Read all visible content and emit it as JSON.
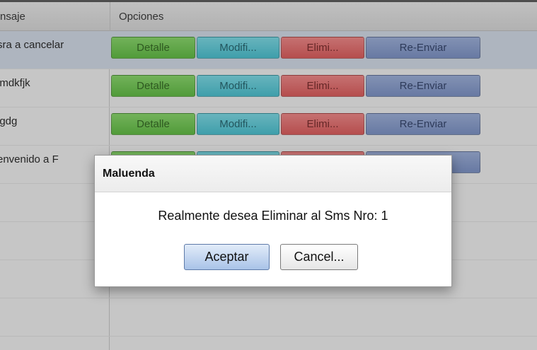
{
  "grid": {
    "columns": [
      "nsaje",
      "Opciones"
    ],
    "rows": [
      {
        "message": "sra a cancelar",
        "selected": true
      },
      {
        "message": "lmdkfjk",
        "selected": false
      },
      {
        "message": "lgdg",
        "selected": false
      },
      {
        "message": "envenido a F",
        "selected": false
      },
      {
        "message": "",
        "selected": false
      },
      {
        "message": "",
        "selected": false
      },
      {
        "message": "",
        "selected": false
      },
      {
        "message": "",
        "selected": false
      }
    ],
    "buttons": {
      "detalle": "Detalle",
      "modificar": "Modifi...",
      "eliminar": "Elimi...",
      "reenviar": "Re-Enviar"
    },
    "colors": {
      "detalle": "#6fd34f",
      "modificar": "#5ad3e3",
      "eliminar": "#f06e6e",
      "reenviar": "#8ea5da",
      "selected_row": "#dfe8f6"
    }
  },
  "dialog": {
    "title": "Maluenda",
    "message": "Realmente desea Eliminar al Sms Nro: 1",
    "accept_label": "Aceptar",
    "cancel_label": "Cancel..."
  }
}
